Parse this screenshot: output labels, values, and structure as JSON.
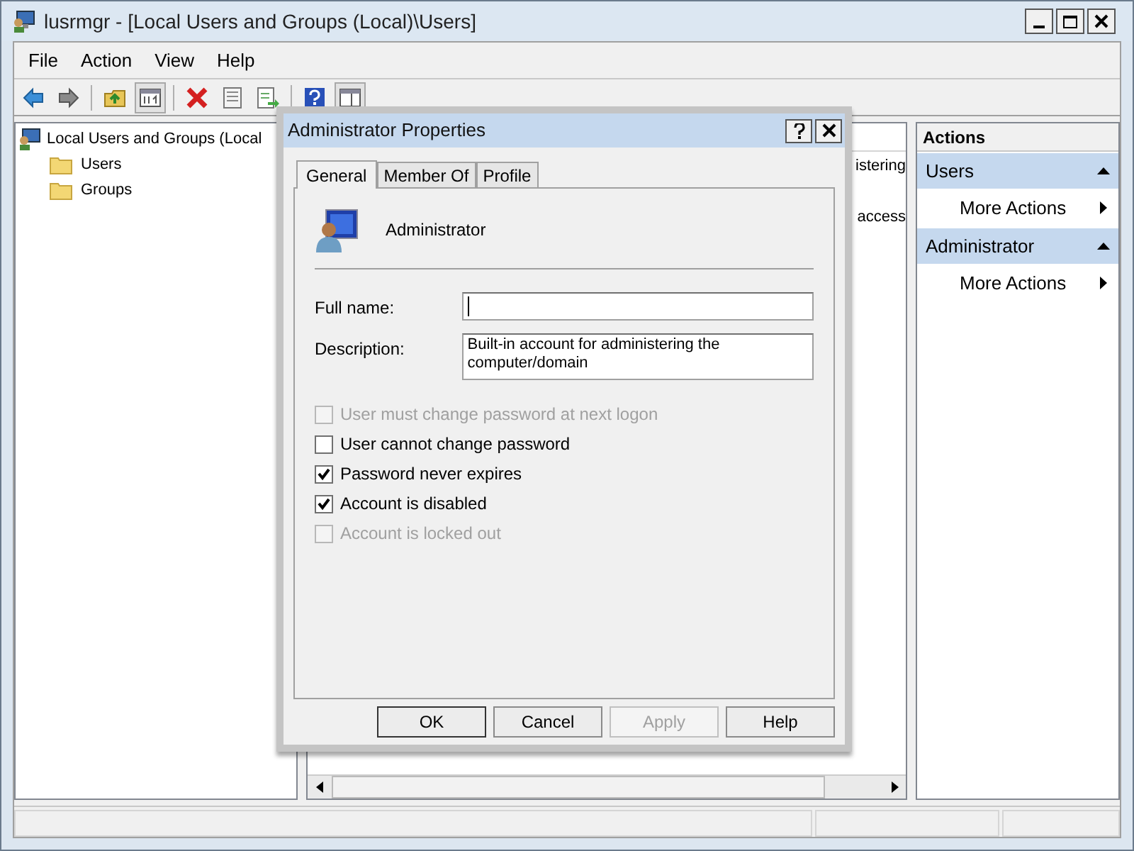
{
  "window": {
    "title": "lusrmgr - [Local Users and Groups (Local)\\Users]"
  },
  "menu": [
    "File",
    "Action",
    "View",
    "Help"
  ],
  "toolbar": [
    {
      "kind": "back",
      "pressed": false
    },
    {
      "kind": "forward",
      "pressed": false
    },
    {
      "kind": "separator"
    },
    {
      "kind": "up",
      "pressed": false
    },
    {
      "kind": "tree",
      "pressed": true
    },
    {
      "kind": "separator"
    },
    {
      "kind": "delete",
      "pressed": false
    },
    {
      "kind": "properties",
      "pressed": false
    },
    {
      "kind": "export",
      "pressed": false
    },
    {
      "kind": "separator"
    },
    {
      "kind": "help",
      "pressed": false
    },
    {
      "kind": "pane",
      "pressed": true
    }
  ],
  "tree": {
    "root": "Local Users and Groups (Local",
    "children": [
      {
        "label": "Users"
      },
      {
        "label": "Groups"
      }
    ]
  },
  "middle_pane": {
    "fragments": [
      "istering",
      "access"
    ]
  },
  "actions": {
    "title": "Actions",
    "sections": [
      {
        "title": "Users",
        "items": [
          "More Actions"
        ]
      },
      {
        "title": "Administrator",
        "items": [
          "More Actions"
        ]
      }
    ]
  },
  "dialog": {
    "title": "Administrator Properties",
    "tabs": [
      {
        "label": "General",
        "selected": true
      },
      {
        "label": "Member Of",
        "selected": false
      },
      {
        "label": "Profile",
        "selected": false
      }
    ],
    "user_name": "Administrator",
    "fields": [
      {
        "label": "Full name:",
        "kind": "line"
      },
      {
        "label": "Description:",
        "kind": "area",
        "value": "Built-in account for administering the computer/domain"
      }
    ],
    "options": [
      {
        "label": "User must change password at next logon",
        "checked": false,
        "disabled": true
      },
      {
        "label": "User cannot change password",
        "checked": false,
        "disabled": false
      },
      {
        "label": "Password never expires",
        "checked": true,
        "disabled": false
      },
      {
        "label": "Account is disabled",
        "checked": true,
        "disabled": false
      },
      {
        "label": "Account is locked out",
        "checked": false,
        "disabled": true
      }
    ],
    "buttons": [
      {
        "label": "OK",
        "disabled": false
      },
      {
        "label": "Cancel",
        "disabled": false
      },
      {
        "label": "Apply",
        "disabled": true
      },
      {
        "label": "Help",
        "disabled": false
      }
    ]
  }
}
